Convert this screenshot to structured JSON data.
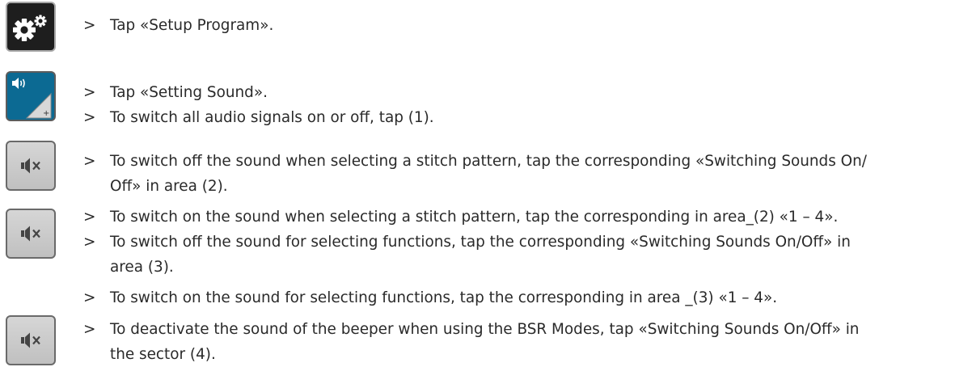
{
  "icons": {
    "setup": "gear-icon",
    "sound": "sound-settings-icon",
    "mute": "speaker-mute-icon",
    "sound_plus": "+"
  },
  "colors": {
    "setup_bg": "#1e1e1e",
    "sound_bg": "#0c6a93",
    "mute_bg": "#c9c9c9",
    "text": "#2a2a2a"
  },
  "steps": [
    {
      "marker": ">",
      "lines": [
        "Tap «Setup Program»."
      ]
    },
    {
      "marker": ">",
      "lines": [
        "Tap «Setting Sound»."
      ]
    },
    {
      "marker": ">",
      "lines": [
        "To switch all audio signals on or off, tap  (1)."
      ]
    },
    {
      "marker": ">",
      "lines": [
        "To switch off the sound when selecting a stitch pattern, tap the corresponding «Switching Sounds On/",
        "Off» in area (2)."
      ]
    },
    {
      "marker": ">",
      "lines": [
        "To switch on the sound when selecting a stitch pattern, tap the corresponding in area_(2) «1 – 4»."
      ]
    },
    {
      "marker": ">",
      "lines": [
        "To switch off the sound for selecting functions, tap the corresponding «Switching Sounds On/Off» in",
        "area (3)."
      ]
    },
    {
      "marker": ">",
      "lines": [
        "To switch on the sound for selecting functions, tap the corresponding in area _(3) «1 – 4»."
      ]
    },
    {
      "marker": ">",
      "lines": [
        "To deactivate the sound of the beeper when using the BSR Modes, tap «Switching Sounds On/Off» in",
        "the sector  (4)."
      ]
    }
  ]
}
